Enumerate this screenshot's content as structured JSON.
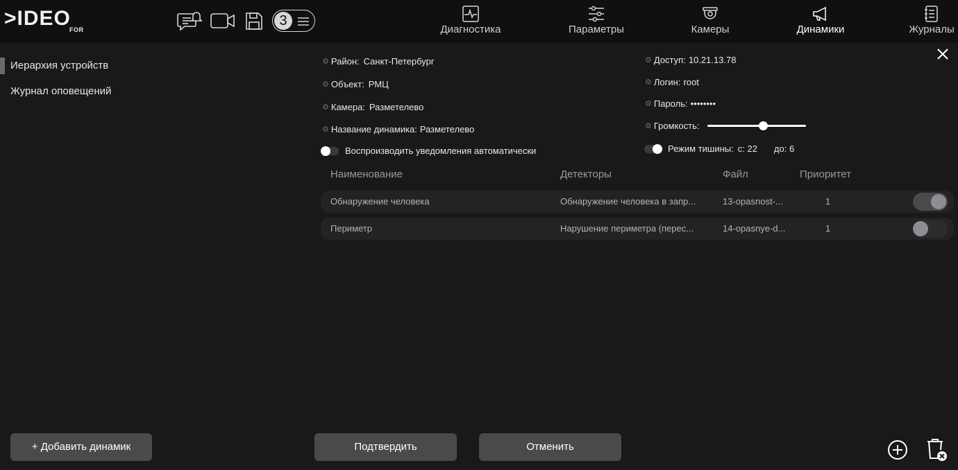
{
  "app": {
    "logo_word": ">IDEO",
    "logo_sub": "FOR"
  },
  "header": {
    "counter": "3",
    "tabs": [
      {
        "label": "Диагностика",
        "icon": "diagnostics-icon"
      },
      {
        "label": "Параметры",
        "icon": "sliders-icon"
      },
      {
        "label": "Камеры",
        "icon": "dome-camera-icon"
      },
      {
        "label": "Динамики",
        "icon": "megaphone-icon",
        "active": true
      },
      {
        "label": "Журналы",
        "icon": "journal-icon"
      }
    ]
  },
  "sidebar": {
    "items": [
      {
        "label": "Иерархия устройств",
        "active": true
      },
      {
        "label": "Журнал оповещений"
      }
    ],
    "add_button": "+ Добавить динамик"
  },
  "details": {
    "district_label": "Район:",
    "district_value": "Санкт-Петербург",
    "object_label": "Объект:",
    "object_value": "РМЦ",
    "camera_label": "Камера:",
    "camera_value": "Разметелево",
    "speaker_label": "Название динамика:",
    "speaker_value": "Разметелево",
    "autoplay_label": "Воспроизводить уведомления автоматически",
    "access_label": "Доступ:",
    "access_value": "10.21.13.78",
    "login_label": "Логин:",
    "login_value": "root",
    "password_label": "Пароль:",
    "password_value": "••••••••",
    "volume_label": "Громкость:",
    "volume_level": 0.57,
    "silence_label": "Режим тишины:",
    "silence_from": "с: 22",
    "silence_to": "до: 6"
  },
  "table": {
    "headers": [
      "Наименование",
      "Детекторы",
      "Файл",
      "Приоритет"
    ],
    "rows": [
      {
        "name": "Обнаружение человека",
        "detectors": "Обнаружение человека в запр...",
        "file": "13-opasnost-...",
        "priority": "1",
        "enabled": true
      },
      {
        "name": "Периметр",
        "detectors": "Нарушение периметра (перес...",
        "file": "14-opasnye-d...",
        "priority": "1",
        "enabled": false
      }
    ]
  },
  "footer": {
    "confirm": "Подтвердить",
    "cancel": "Отменить"
  }
}
